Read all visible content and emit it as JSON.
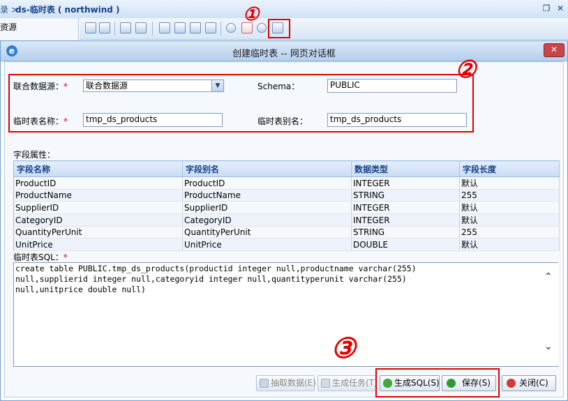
{
  "app": {
    "crumb_prefix": "录 >",
    "title": "ds-临时表 ( northwind )",
    "left_item": "资源",
    "window_restore": "❐",
    "window_close": "✕"
  },
  "annotations": [
    "①",
    "②",
    "③"
  ],
  "dialog": {
    "title": "创建临时表 -- 网页对话框",
    "close_glyph": "✕",
    "form": {
      "datasource_label": "联合数据源：",
      "datasource_value": "联合数据源",
      "schema_label": "Schema：",
      "schema_value": "PUBLIC",
      "tmpname_label": "临时表名称：",
      "tmpname_value": "tmp_ds_products",
      "alias_label": "临时表别名：",
      "alias_value": "tmp_ds_products",
      "required_mark": "*"
    },
    "fields_label": "字段属性：",
    "table": {
      "headers": [
        "字段名称",
        "字段别名",
        "数据类型",
        "字段长度"
      ],
      "rows": [
        [
          "ProductID",
          "ProductID",
          "INTEGER",
          "默认"
        ],
        [
          "ProductName",
          "ProductName",
          "STRING",
          "255"
        ],
        [
          "SupplierID",
          "SupplierID",
          "INTEGER",
          "默认"
        ],
        [
          "CategoryID",
          "CategoryID",
          "INTEGER",
          "默认"
        ],
        [
          "QuantityPerUnit",
          "QuantityPerUnit",
          "STRING",
          "255"
        ],
        [
          "UnitPrice",
          "UnitPrice",
          "DOUBLE",
          "默认"
        ]
      ]
    },
    "sql_label": "临时表SQL：",
    "sql_text": "create table PUBLIC.tmp_ds_products(productid integer null,productname varchar(255)\nnull,supplierid integer null,categoryid integer null,quantityperunit varchar(255)\nnull,unitprice double null)",
    "buttons": {
      "extract": "抽取数据(E)",
      "gen_task": "生成任务(T)",
      "gen_sql": "生成SQL(S)",
      "save": "保存(S)",
      "close": "关闭(C)"
    }
  },
  "colors": {
    "annotation": "#e00000",
    "header_text": "#15428b"
  }
}
